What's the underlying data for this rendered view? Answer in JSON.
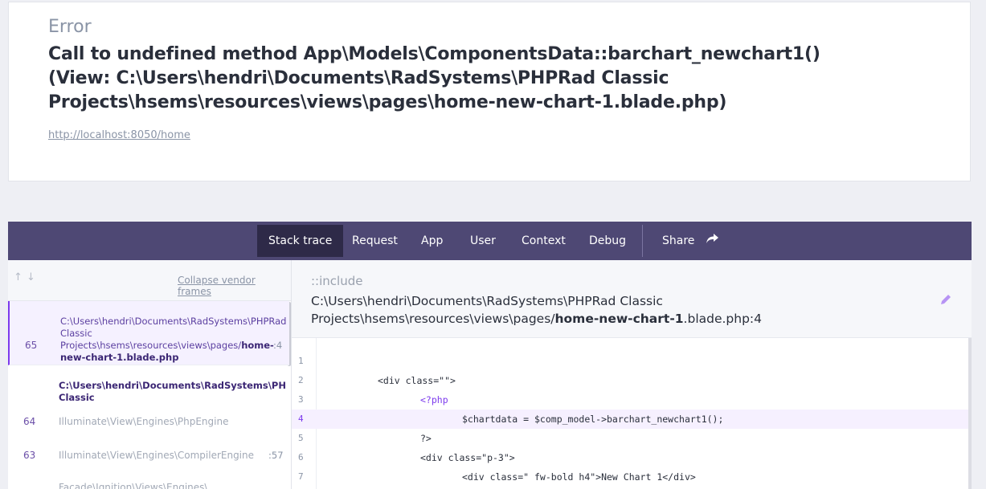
{
  "error": {
    "label": "Error",
    "message": "Call to undefined method App\\Models\\ComponentsData::barchart_newchart1() (View: C:\\Users\\hendri\\Documents\\RadSystems\\PHPRad Classic Projects\\hsems\\resources\\views\\pages\\home-new-chart-1.blade.php)",
    "url": "http://localhost:8050/home"
  },
  "tabs": {
    "stack_trace": "Stack trace",
    "request": "Request",
    "app": "App",
    "user": "User",
    "context": "Context",
    "debug": "Debug",
    "share": "Share"
  },
  "left": {
    "collapse_label": "Collapse vendor frames",
    "frames": [
      {
        "number": "65",
        "path_prefix": "C:\\Users\\hendri\\Documents\\RadSystems\\PHPRad Classic Projects\\hsems\\resources\\views\\pages/",
        "path_file": "home-new-chart-1.blade.php",
        "line": ":4"
      },
      {
        "path": "C:\\Users\\hendri\\Documents\\RadSystems\\PHPRad Classic Projects\\hsems\\vendor\\laravel\\framework\\src\\Illuminate"
      },
      {
        "number": "64",
        "class": "Illuminate\\View\\Engines\\PhpEngine"
      },
      {
        "number": "63",
        "class": "Illuminate\\View\\Engines\\CompilerEngine",
        "line": ":57"
      },
      {
        "class": "Facade\\Ignition\\Views\\Engines\\"
      }
    ]
  },
  "right": {
    "include_label": "::include",
    "file_path_prefix": "C:\\Users\\hendri\\Documents\\RadSystems\\PHPRad Classic Projects\\hsems\\resources\\views\\pages/",
    "file_path_bold1": "home-new-chart-1",
    "file_path_mid": ".blade.php:4",
    "code": [
      {
        "n": "1",
        "text": ""
      },
      {
        "n": "2",
        "text": "<div class=\"\">"
      },
      {
        "n": "3",
        "text": "<?php"
      },
      {
        "n": "4",
        "text": "$chartdata = $comp_model->barchart_newchart1();"
      },
      {
        "n": "5",
        "text": "?>"
      },
      {
        "n": "6",
        "text": "<div class=\"p-3\">"
      },
      {
        "n": "7",
        "text": "<div class=\" fw-bold h4\">New Chart 1</div>"
      }
    ]
  }
}
